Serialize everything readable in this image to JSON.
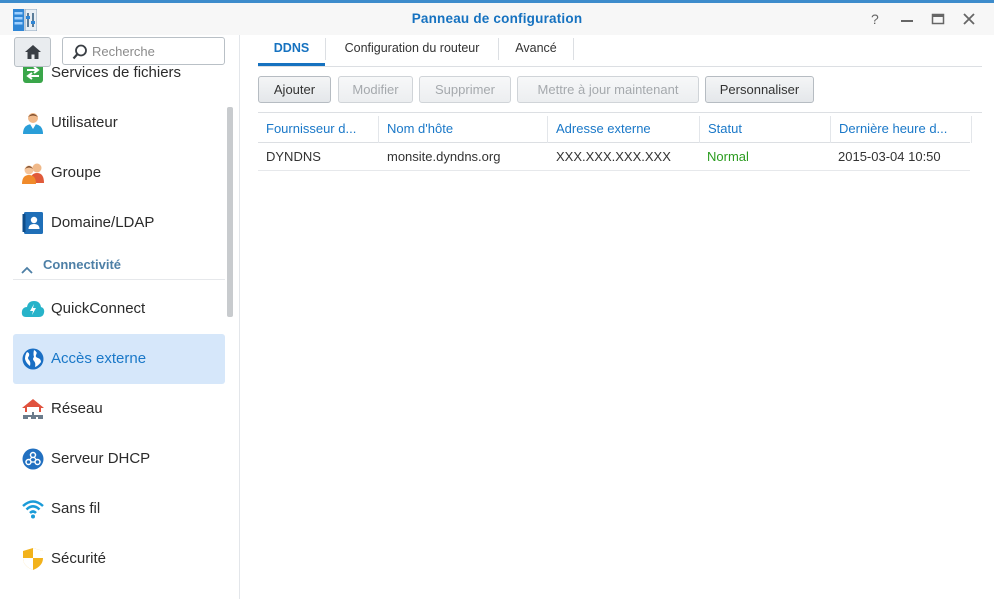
{
  "window": {
    "title": "Panneau de configuration",
    "accent_color": "#1672c0"
  },
  "sidebar": {
    "search_placeholder": "Recherche",
    "items_top": [
      {
        "label": "Services de fichiers",
        "icon": "file-services-icon"
      },
      {
        "label": "Utilisateur",
        "icon": "user-icon"
      },
      {
        "label": "Groupe",
        "icon": "group-icon"
      },
      {
        "label": "Domaine/LDAP",
        "icon": "domain-ldap-icon"
      }
    ],
    "section": {
      "label": "Connectivité",
      "icon": "chevron-up-icon"
    },
    "items_bottom": [
      {
        "label": "QuickConnect",
        "icon": "quickconnect-icon"
      },
      {
        "label": "Accès externe",
        "icon": "external-access-icon",
        "active": true
      },
      {
        "label": "Réseau",
        "icon": "network-icon"
      },
      {
        "label": "Serveur DHCP",
        "icon": "dhcp-server-icon"
      },
      {
        "label": "Sans fil",
        "icon": "wireless-icon"
      },
      {
        "label": "Sécurité",
        "icon": "security-icon"
      }
    ]
  },
  "tabs": [
    {
      "label": "DDNS",
      "active": true
    },
    {
      "label": "Configuration du routeur",
      "active": false
    },
    {
      "label": "Avancé",
      "active": false
    }
  ],
  "toolbar": [
    {
      "label": "Ajouter",
      "enabled": true
    },
    {
      "label": "Modifier",
      "enabled": false
    },
    {
      "label": "Supprimer",
      "enabled": false
    },
    {
      "label": "Mettre à jour maintenant",
      "enabled": false
    },
    {
      "label": "Personnaliser",
      "enabled": true
    }
  ],
  "grid": {
    "columns": [
      "Fournisseur d...",
      "Nom d'hôte",
      "Adresse externe",
      "Statut",
      "Dernière heure d..."
    ],
    "rows": [
      [
        "DYNDNS",
        "monsite.dyndns.org",
        "XXX.XXX.XXX.XXX",
        "Normal",
        "2015-03-04 10:50"
      ]
    ],
    "status_color": "#2a9c1f"
  }
}
